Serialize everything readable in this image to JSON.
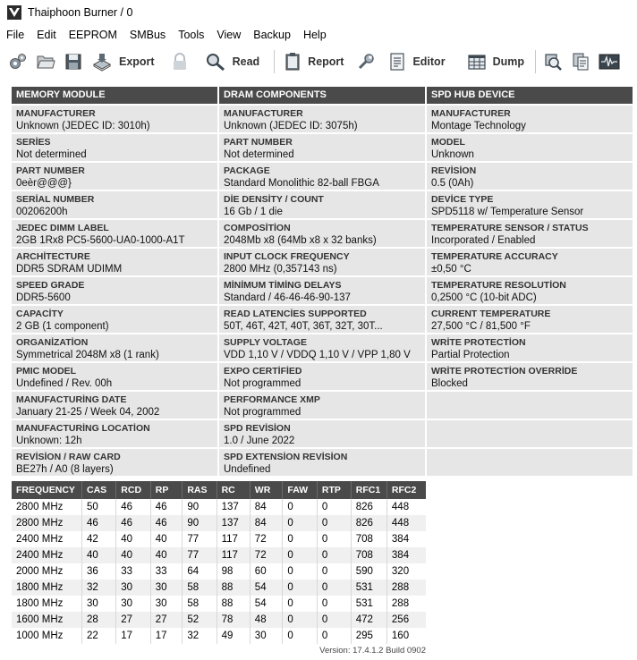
{
  "window": {
    "title": "Thaiphoon Burner / 0"
  },
  "menu": [
    "File",
    "Edit",
    "EEPROM",
    "SMBus",
    "Tools",
    "View",
    "Backup",
    "Help"
  ],
  "toolbar": {
    "export_label": "Export",
    "read_label": "Read",
    "report_label": "Report",
    "editor_label": "Editor",
    "dump_label": "Dump"
  },
  "columns": [
    {
      "header": "MEMORY MODULE",
      "fields": [
        {
          "label": "MANUFACTURER",
          "value": "Unknown (JEDEC ID: 3010h)"
        },
        {
          "label": "SERİES",
          "value": "Not determined"
        },
        {
          "label": "PART NUMBER",
          "value": "0eèr@@@}"
        },
        {
          "label": "SERİAL NUMBER",
          "value": "00206200h"
        },
        {
          "label": "JEDEC DIMM LABEL",
          "value": "2GB 1Rx8 PC5-5600-UA0-1000-A1T"
        },
        {
          "label": "ARCHİTECTURE",
          "value": "DDR5 SDRAM UDIMM"
        },
        {
          "label": "SPEED GRADE",
          "value": "DDR5-5600"
        },
        {
          "label": "CAPACİTY",
          "value": "2 GB (1 component)"
        },
        {
          "label": "ORGANİZATİON",
          "value": "Symmetrical 2048M x8 (1 rank)"
        },
        {
          "label": "PMIC MODEL",
          "value": "Undefined / Rev. 00h"
        },
        {
          "label": "MANUFACTURİNG DATE",
          "value": "January 21-25 / Week 04, 2002"
        },
        {
          "label": "MANUFACTURİNG LOCATİON",
          "value": "Unknown: 12h"
        },
        {
          "label": "REVİSİON / RAW CARD",
          "value": "BE27h / A0 (8 layers)"
        }
      ]
    },
    {
      "header": "DRAM COMPONENTS",
      "fields": [
        {
          "label": "MANUFACTURER",
          "value": "Unknown (JEDEC ID: 3075h)"
        },
        {
          "label": "PART NUMBER",
          "value": "Not determined"
        },
        {
          "label": "PACKAGE",
          "value": "Standard Monolithic 82-ball FBGA"
        },
        {
          "label": "DİE DENSİTY / COUNT",
          "value": "16 Gb / 1 die"
        },
        {
          "label": "COMPOSİTİON",
          "value": "2048Mb x8 (64Mb x8 x 32 banks)"
        },
        {
          "label": "INPUT CLOCK FREQUENCY",
          "value": "2800 MHz (0,357143 ns)"
        },
        {
          "label": "MİNİMUM TİMİNG DELAYS",
          "value": "Standard / 46-46-46-90-137"
        },
        {
          "label": "READ LATENCİES SUPPORTED",
          "value": "50T, 46T, 42T, 40T, 36T, 32T, 30T..."
        },
        {
          "label": "SUPPLY VOLTAGE",
          "value": "VDD 1,10 V / VDDQ 1,10 V / VPP 1,80 V"
        },
        {
          "label": "EXPO CERTİFİED",
          "value": "Not programmed"
        },
        {
          "label": "PERFORMANCE XMP",
          "value": "Not programmed"
        },
        {
          "label": "SPD REVİSİON",
          "value": "1.0 / June 2022"
        },
        {
          "label": "SPD EXTENSİON REVİSİON",
          "value": "Undefined"
        }
      ]
    },
    {
      "header": "SPD HUB DEVICE",
      "fields": [
        {
          "label": "MANUFACTURER",
          "value": "Montage Technology"
        },
        {
          "label": "MODEL",
          "value": "Unknown"
        },
        {
          "label": "REVİSİON",
          "value": "0.5 (0Ah)"
        },
        {
          "label": "DEVİCE TYPE",
          "value": "SPD5118 w/ Temperature Sensor"
        },
        {
          "label": "TEMPERATURE SENSOR / STATUS",
          "value": "Incorporated / Enabled"
        },
        {
          "label": "TEMPERATURE ACCURACY",
          "value": "±0,50 °C"
        },
        {
          "label": "TEMPERATURE RESOLUTİON",
          "value": "0,2500 °C (10-bit ADC)"
        },
        {
          "label": "CURRENT TEMPERATURE",
          "value": "27,500 °C / 81,500 °F"
        },
        {
          "label": "WRİTE PROTECTİON",
          "value": "Partial Protection"
        },
        {
          "label": "WRİTE PROTECTİON OVERRİDE",
          "value": "Blocked"
        },
        {
          "label": "",
          "value": ""
        },
        {
          "label": "",
          "value": ""
        },
        {
          "label": "",
          "value": ""
        }
      ]
    }
  ],
  "timings": {
    "headers": [
      "FREQUENCY",
      "CAS",
      "RCD",
      "RP",
      "RAS",
      "RC",
      "WR",
      "FAW",
      "RTP",
      "RFC1",
      "RFC2"
    ],
    "rows": [
      [
        "2800 MHz",
        "50",
        "46",
        "46",
        "90",
        "137",
        "84",
        "0",
        "0",
        "826",
        "448"
      ],
      [
        "2800 MHz",
        "46",
        "46",
        "46",
        "90",
        "137",
        "84",
        "0",
        "0",
        "826",
        "448"
      ],
      [
        "2400 MHz",
        "42",
        "40",
        "40",
        "77",
        "117",
        "72",
        "0",
        "0",
        "708",
        "384"
      ],
      [
        "2400 MHz",
        "40",
        "40",
        "40",
        "77",
        "117",
        "72",
        "0",
        "0",
        "708",
        "384"
      ],
      [
        "2000 MHz",
        "36",
        "33",
        "33",
        "64",
        "98",
        "60",
        "0",
        "0",
        "590",
        "320"
      ],
      [
        "1800 MHz",
        "32",
        "30",
        "30",
        "58",
        "88",
        "54",
        "0",
        "0",
        "531",
        "288"
      ],
      [
        "1800 MHz",
        "30",
        "30",
        "30",
        "58",
        "88",
        "54",
        "0",
        "0",
        "531",
        "288"
      ],
      [
        "1600 MHz",
        "28",
        "27",
        "27",
        "52",
        "78",
        "48",
        "0",
        "0",
        "472",
        "256"
      ],
      [
        "1000 MHz",
        "22",
        "17",
        "17",
        "32",
        "49",
        "30",
        "0",
        "0",
        "295",
        "160"
      ]
    ]
  },
  "version": "Version: 17.4.1.2 Build 0902",
  "icons": [
    "app-logo-icon",
    "settings-gears-icon",
    "folder-open-icon",
    "save-disk-icon",
    "export-icon",
    "lock-icon",
    "read-magnifier-icon",
    "report-clipboard-icon",
    "tools-wrench-icon",
    "editor-document-icon",
    "dump-grid-icon",
    "search-chip-icon",
    "copy-pages-icon",
    "oscilloscope-icon"
  ]
}
